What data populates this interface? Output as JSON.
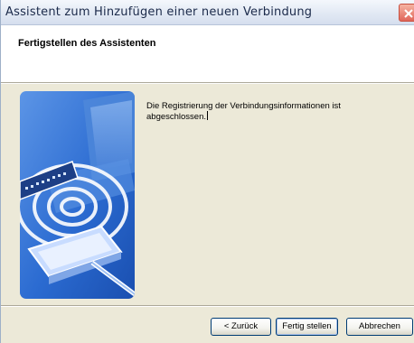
{
  "window": {
    "title": "Assistent zum Hinzufügen einer neuen Verbindung"
  },
  "header": {
    "title": "Fertigstellen des Assistenten"
  },
  "main": {
    "message": "Die Registrierung der Verbindungsinformationen ist abgeschlossen.",
    "illustration_icon": "wireless-network-illustration"
  },
  "buttons": {
    "back": "< Zurück",
    "finish": "Fertig stellen",
    "cancel": "Abbrechen"
  },
  "colors": {
    "window_bg": "#ece9d8",
    "illustration_blue": "#2a6fd0"
  }
}
